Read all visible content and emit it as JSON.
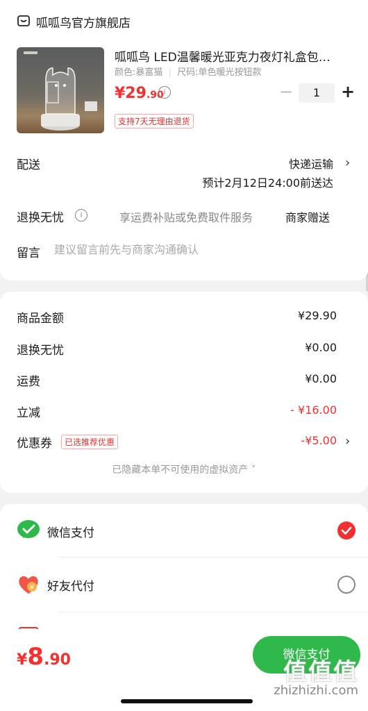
{
  "shop": {
    "name": "呱呱鸟官方旗舰店",
    "icon": "shop-icon"
  },
  "product": {
    "title": "呱呱鸟 LED温馨暖光亚克力夜灯礼盒包…",
    "spec_color": "颜色:暴富猫",
    "spec_size": "尺码:单色暖光按钮款",
    "price_main": "¥29",
    "price_decimal": ".90",
    "quantity": "1",
    "minus_label": "−",
    "plus_label": "+",
    "return_badge": "支持7天无理由退货"
  },
  "delivery": {
    "label": "配送",
    "method": "快递运输",
    "eta": "预计2月12日24:00前送达"
  },
  "worry_free": {
    "label": "退换无忧",
    "desc": "享运费补贴或免费取件服务",
    "gift": "商家赠送"
  },
  "note": {
    "label": "留言",
    "placeholder": "建议留言前先与商家沟通确认"
  },
  "breakdown": {
    "goods_label": "商品金额",
    "goods_value": "¥29.90",
    "worryfree_label": "退换无忧",
    "worryfree_value": "¥0.00",
    "shipping_label": "运费",
    "shipping_value": "¥0.00",
    "discount_label": "立减",
    "discount_value": "- ¥16.00",
    "coupon_label": "优惠券",
    "coupon_tag": "已选推荐优惠",
    "coupon_value": "-¥5.00",
    "hidden_assets": "已隐藏本单不可使用的虚拟资产 ˅"
  },
  "payment": {
    "wechat_label": "微信支付",
    "friend_label": "好友代付",
    "selected": "wechat"
  },
  "footer": {
    "total_symbol": "¥",
    "total_main": "8",
    "total_decimal": ".90",
    "pay_button": "微信支付",
    "watermark_logo": "值值值",
    "watermark_url": "zhizhizhi.com"
  },
  "colors": {
    "accent": "#f23030",
    "wechat_green": "#2fb94a",
    "muted": "#999999"
  }
}
